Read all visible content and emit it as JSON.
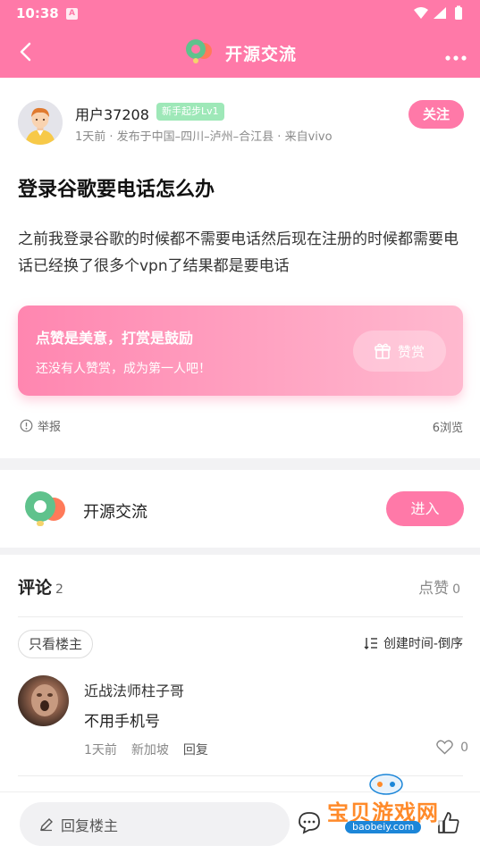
{
  "status_bar": {
    "time": "10:38",
    "app_indicator": "A"
  },
  "header": {
    "title": "开源交流",
    "back_icon": "back-arrow-icon",
    "more_icon": "more-dots-icon",
    "accent_color": "#ff79a8"
  },
  "post": {
    "username": "用户37208",
    "level_badge": "新手起步Lv1",
    "meta": "1天前 · 发布于中国–四川–泸州–合江县 · 来自vivo",
    "follow_label": "关注",
    "title": "登录谷歌要电话怎么办",
    "body": "之前我登录谷歌的时候都不需要电话然后现在注册的时候都需要电话已经换了很多个vpn了结果都是要电话"
  },
  "reward": {
    "title": "点赞是美意，打赏是鼓励",
    "subtitle": "还没有人赞赏，成为第一人吧！",
    "button_label": "赞赏"
  },
  "post_footer": {
    "report_label": "举报",
    "views_label": "6浏览"
  },
  "forum": {
    "name": "开源交流",
    "enter_label": "进入"
  },
  "comments_section": {
    "title": "评论",
    "count": "2",
    "likes_label": "点赞",
    "likes_count": "0",
    "filter_label": "只看楼主",
    "sort_label": "创建时间-倒序"
  },
  "comments": [
    {
      "author": "近战法师柱子哥",
      "text": "不用手机号",
      "time": "1天前",
      "location": "新加坡",
      "reply_label": "回复",
      "likes": "0"
    }
  ],
  "bottom_bar": {
    "reply_placeholder": "回复楼主"
  },
  "watermark": {
    "text": "宝贝游戏网",
    "url": "baobeiy.com"
  }
}
